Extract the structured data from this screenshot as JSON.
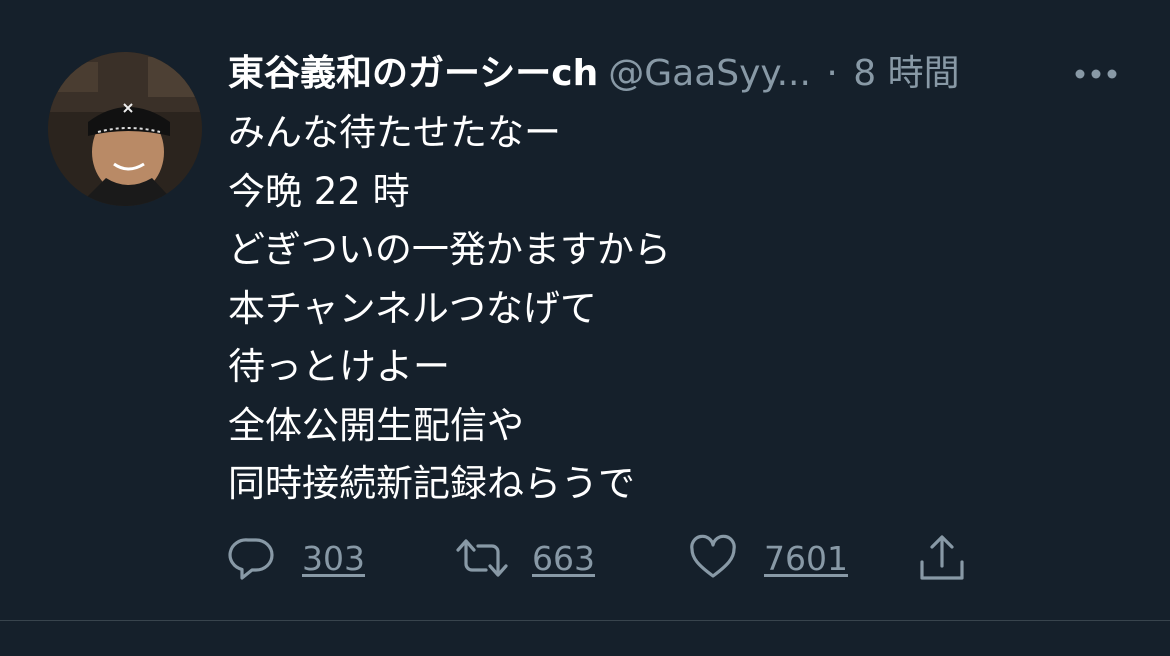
{
  "tweet": {
    "display_name": "東谷義和のガーシーch",
    "handle": "@GaaSyy...",
    "separator": "·",
    "time": "8 時間",
    "lines": [
      "みんな待たせたなー",
      "今晩 22 時",
      "どぎついの一発かますから",
      "本チャンネルつなげて",
      "待っとけよー",
      "全体公開生配信や",
      "同時接続新記録ねらうで"
    ]
  },
  "actions": {
    "reply_count": "303",
    "retweet_count": "663",
    "like_count": "7601"
  },
  "icons": {
    "reply": "speech-bubble-icon",
    "retweet": "retweet-arrows-icon",
    "like": "heart-icon",
    "share": "share-upload-icon",
    "more": "ellipsis-icon"
  },
  "colors": {
    "background": "#15202b",
    "primary_text": "#ffffff",
    "secondary_text": "#8899a6",
    "divider": "#38444d"
  }
}
